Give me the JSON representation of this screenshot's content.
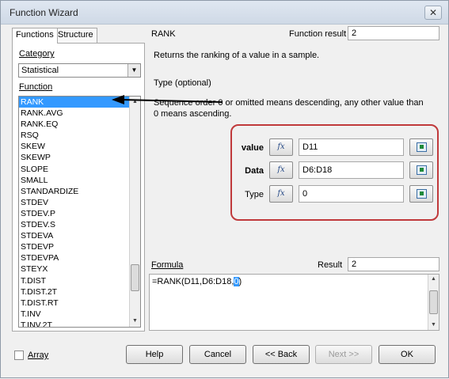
{
  "window": {
    "title": "Function Wizard",
    "close_glyph": "✕"
  },
  "tabs": {
    "functions": "Functions",
    "structure": "Structure"
  },
  "category": {
    "label": "Category",
    "selected": "Statistical"
  },
  "function_list": {
    "label": "Function",
    "selected": "RANK",
    "items": [
      "RANK",
      "RANK.AVG",
      "RANK.EQ",
      "RSQ",
      "SKEW",
      "SKEWP",
      "SLOPE",
      "SMALL",
      "STANDARDIZE",
      "STDEV",
      "STDEV.P",
      "STDEV.S",
      "STDEVA",
      "STDEVP",
      "STDEVPA",
      "STEYX",
      "T.DIST",
      "T.DIST.2T",
      "T.DIST.RT",
      "T.INV",
      "T.INV.2T"
    ]
  },
  "function_info": {
    "name": "RANK",
    "result_label": "Function result",
    "result_value": "2",
    "description": "Returns the ranking of a value in a sample.",
    "param_heading": "Type (optional)",
    "param_description": "Sequence order 0 or omitted means descending, any other value than 0 means ascending."
  },
  "arguments": [
    {
      "label": "value",
      "value": "D11",
      "fx_glyph": "fx"
    },
    {
      "label": "Data",
      "value": "D6:D18",
      "fx_glyph": "fx"
    },
    {
      "label": "Type",
      "value": "0",
      "fx_glyph": "fx"
    }
  ],
  "formula": {
    "label": "Formula",
    "result_label": "Result",
    "result_value": "2",
    "prefix": "=RANK(D11,D6:D18,",
    "highlight": "0",
    "suffix": ")"
  },
  "array_label": "Array",
  "buttons": {
    "help": "Help",
    "cancel": "Cancel",
    "back": "<< Back",
    "next": "Next >>",
    "ok": "OK"
  },
  "colors": {
    "selection": "#3399ff",
    "annotation_red": "#c0393b",
    "annotation_arrow": "#000000"
  }
}
